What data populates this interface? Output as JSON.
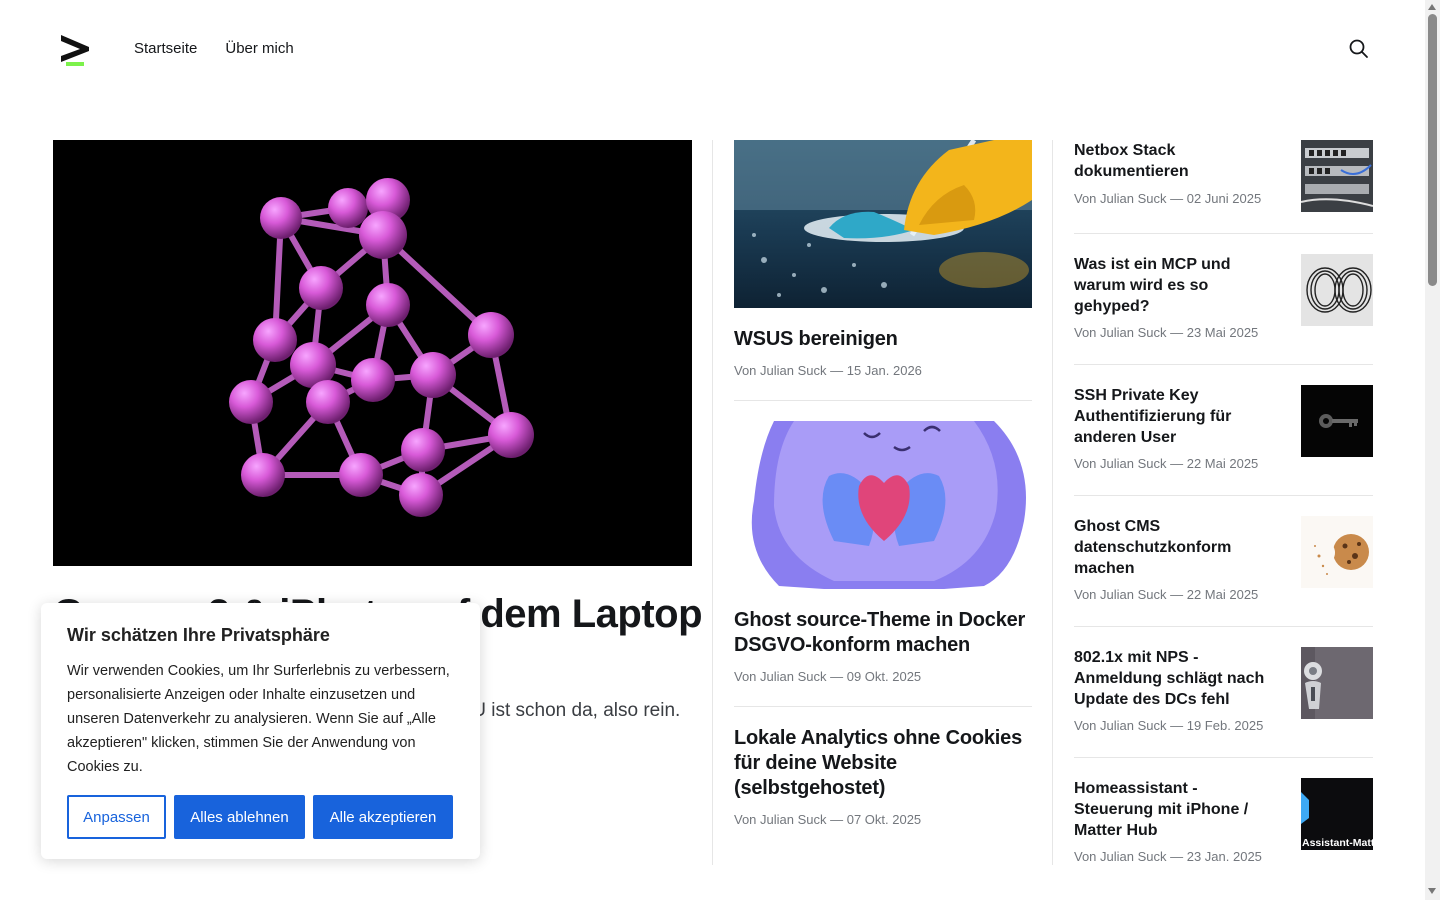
{
  "nav": {
    "items": [
      {
        "label": "Startseite"
      },
      {
        "label": "Über mich"
      }
    ]
  },
  "hero": {
    "title": "Gemma 3 & iPhoto auf dem Laptop lokal verbinden",
    "excerpt": "Kein Cloud-Abo für KI in Sicht. Der Laptop mit GPU ist schon da, also rein. Mit Ollama und..."
  },
  "middle": [
    {
      "title": "WSUS bereinigen",
      "meta": "Von Julian Suck — 15 Jan. 2026"
    },
    {
      "title": "Ghost source-Theme in Docker DSGVO-konform machen",
      "meta": "Von Julian Suck — 09 Okt. 2025"
    },
    {
      "title": "Lokale Analytics ohne Cookies für deine Website (selbstgehostet)",
      "meta": "Von Julian Suck — 07 Okt. 2025"
    }
  ],
  "side": [
    {
      "title": "Netbox Stack dokumentieren",
      "meta": "Von Julian Suck — 02 Juni 2025"
    },
    {
      "title": "Was ist ein MCP und warum wird es so gehyped?",
      "meta": "Von Julian Suck — 23 Mai 2025"
    },
    {
      "title": "SSH Private Key Authentifizierung für anderen User",
      "meta": "Von Julian Suck — 22 Mai 2025"
    },
    {
      "title": "Ghost CMS datenschutzkonform machen",
      "meta": "Von Julian Suck — 22 Mai 2025"
    },
    {
      "title": "802.1x mit NPS - Anmeldung schlägt nach Update des DCs fehl",
      "meta": "Von Julian Suck — 19 Feb. 2025"
    },
    {
      "title": "Homeassistant - Steuerung mit iPhone / Matter Hub",
      "meta": "Von Julian Suck — 23 Jan. 2025",
      "thumb_text": "Assistant-Matte"
    }
  ],
  "cookie": {
    "title": "Wir schätzen Ihre Privatsphäre",
    "text": "Wir verwenden Cookies, um Ihr Surferlebnis zu verbessern, personalisierte Anzeigen oder Inhalte einzusetzen und unseren Datenverkehr zu analysieren. Wenn Sie auf „Alle akzeptieren\" klicken, stimmen Sie der Anwendung von Cookies zu.",
    "customize": "Anpassen",
    "reject": "Alles ablehnen",
    "accept": "Alle akzeptieren"
  },
  "colors": {
    "accent": "#1863dc",
    "logo_accent": "#7cf24b"
  },
  "icons": {
    "search": "search-icon",
    "logo": "logo-icon"
  }
}
